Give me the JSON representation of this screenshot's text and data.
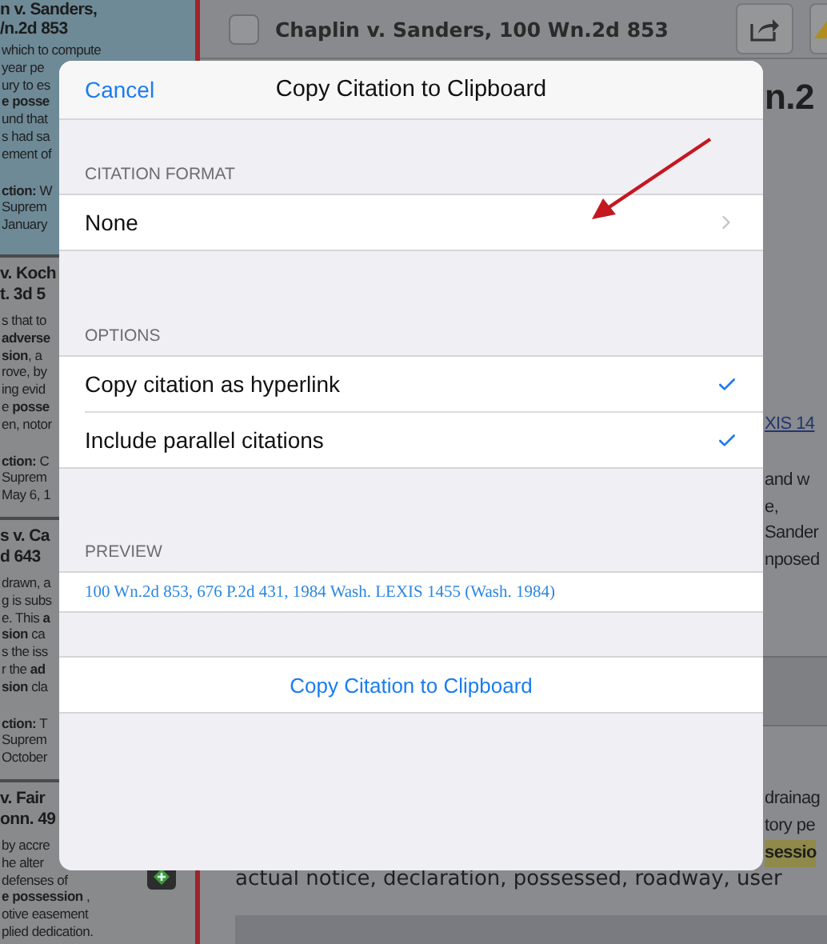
{
  "case_list": [
    {
      "selected": true,
      "title_lines": [
        "n v. Sanders,",
        "/n.2d 853"
      ],
      "snippet_lines": [
        "which to compute",
        "year pe",
        "ury to es",
        "**e posse**",
        "und that",
        "s had sa",
        "ement of"
      ],
      "footer_lines": [
        "**ction:** W",
        "Suprem",
        "January"
      ]
    },
    {
      "selected": false,
      "title_lines": [
        "v. Koch",
        "t. 3d 5"
      ],
      "snippet_lines": [
        "s that to",
        "**adverse**",
        "**sion**, a",
        "rove, by",
        "ing evid",
        "e **posse**",
        "en, notor"
      ],
      "footer_lines": [
        "**ction:** C",
        "Suprem",
        "May 6, 1"
      ]
    },
    {
      "selected": false,
      "title_lines": [
        "s v. Ca",
        "d 643"
      ],
      "snippet_lines": [
        "drawn, a",
        "g is subs",
        "e. This **a**",
        "**sion** ca",
        "s the iss",
        "r the **ad**",
        "**sion** cla"
      ],
      "footer_lines": [
        "**ction:** T",
        "Suprem",
        "October"
      ]
    },
    {
      "selected": false,
      "title_lines": [
        "v. Fair",
        "onn. 49"
      ],
      "snippet_lines": [
        "by accre",
        "he alter",
        "defenses of",
        "**e possession** ,",
        "otive easement",
        "plied dedication."
      ]
    }
  ],
  "document": {
    "header": {
      "title": "Chaplin v. Sanders, 100 Wn.2d 853",
      "checked": false
    },
    "heading": "n.2",
    "link": "XIS 14",
    "paragraph_lines": [
      "and w",
      "e,",
      "Sander",
      "nposed"
    ],
    "keyword_lines": [
      {
        "text": "drainag",
        "highlighted": false
      },
      {
        "text": "tory pe",
        "highlighted": false
      },
      {
        "text": "sessio",
        "highlighted": true
      }
    ],
    "summary": "actual notice, declaration, possessed, roadway, user"
  },
  "dialog": {
    "cancel": "Cancel",
    "title": "Copy Citation to Clipboard",
    "sections": [
      {
        "header": "CITATION FORMAT",
        "rows": [
          {
            "kind": "disclosure",
            "label": "None"
          }
        ]
      },
      {
        "header": "OPTIONS",
        "rows": [
          {
            "kind": "toggle",
            "label": "Copy citation as hyperlink",
            "checked": true
          },
          {
            "kind": "toggle",
            "label": "Include parallel citations",
            "checked": true
          }
        ]
      },
      {
        "header": "PREVIEW",
        "rows": [
          {
            "kind": "preview",
            "label": "100 Wn.2d 853, 676 P.2d 431, 1984 Wash. LEXIS 1455 (Wash. 1984)"
          }
        ]
      }
    ],
    "action": "Copy Citation to Clipboard"
  }
}
